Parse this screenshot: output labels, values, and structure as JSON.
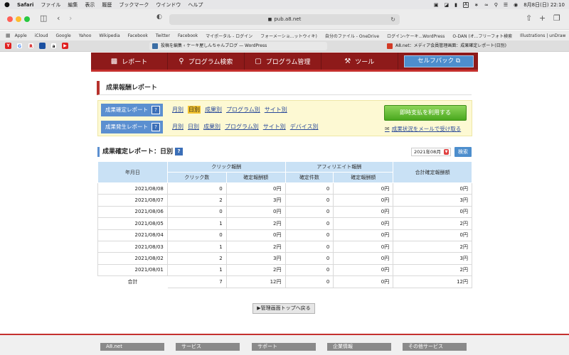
{
  "menubar": {
    "apple": "",
    "items": [
      "Safari",
      "ファイル",
      "編集",
      "表示",
      "履歴",
      "ブックマーク",
      "ウインドウ",
      "ヘルプ"
    ],
    "a_badge": "A",
    "clock": "8月8日(日)  22:10"
  },
  "browser": {
    "url": "pub.a8.net",
    "bookmarks": [
      "Apple",
      "iCloud",
      "Google",
      "Yahoo",
      "Wikipedia",
      "Facebook",
      "Twitter",
      "Facebook",
      "マイポータル - ログイン",
      "フォーメーショ...ットウィキ)",
      "自分のファイル - OneDrive",
      "ログイン‹ケーキ...WordPress",
      "O-DAN (オ...フリーフォト検索",
      "Illustrations | unDraw"
    ],
    "tab1": "投稿を編集 ‹ ケーキ屋しんちゃんブログ — WordPress",
    "tab2": "A8.net：メディア会員管理画面：成果確定レポート(日別)"
  },
  "nav": {
    "items": [
      "レポート",
      "プログラム検索",
      "プログラム管理",
      "ツール"
    ],
    "selfback": "セルフバック"
  },
  "section_title": "成果報酬レポート",
  "filters": {
    "confirmed_label": "成果確定レポート",
    "confirmed_links": [
      "月別",
      "日別",
      "成果別",
      "プログラム別",
      "サイト別"
    ],
    "occurred_label": "成果発生レポート",
    "occurred_links": [
      "月別",
      "日別",
      "成果別",
      "プログラム別",
      "サイト別",
      "デバイス別"
    ],
    "help": "?"
  },
  "instant_button": "即時支払を利用する",
  "mail_link": "成果状況をメールで受け取る",
  "report": {
    "title": "成果確定レポート：日別",
    "month": "2021年08月",
    "search": "検索",
    "headers": {
      "date": "年月日",
      "click_group": "クリック報酬",
      "click_count": "クリック数",
      "click_amount": "確定報酬額",
      "affiliate_group": "アフィリエイト報酬",
      "aff_count": "確定件数",
      "aff_amount": "確定報酬額",
      "total": "合計確定報酬額"
    },
    "rows": [
      [
        "2021/08/08",
        "0",
        "0円",
        "0",
        "0円",
        "0円"
      ],
      [
        "2021/08/07",
        "2",
        "3円",
        "0",
        "0円",
        "3円"
      ],
      [
        "2021/08/06",
        "0",
        "0円",
        "0",
        "0円",
        "0円"
      ],
      [
        "2021/08/05",
        "1",
        "2円",
        "0",
        "0円",
        "2円"
      ],
      [
        "2021/08/04",
        "0",
        "0円",
        "0",
        "0円",
        "0円"
      ],
      [
        "2021/08/03",
        "1",
        "2円",
        "0",
        "0円",
        "2円"
      ],
      [
        "2021/08/02",
        "2",
        "3円",
        "0",
        "0円",
        "3円"
      ],
      [
        "2021/08/01",
        "1",
        "2円",
        "0",
        "0円",
        "2円"
      ]
    ],
    "total_row": [
      "合計",
      "7",
      "12円",
      "0",
      "0円",
      "12円"
    ]
  },
  "back_button": "▶管理画面トップへ戻る",
  "footer": [
    "A8.net",
    "サービス",
    "サポート",
    "企業情報",
    "その他サービス"
  ]
}
